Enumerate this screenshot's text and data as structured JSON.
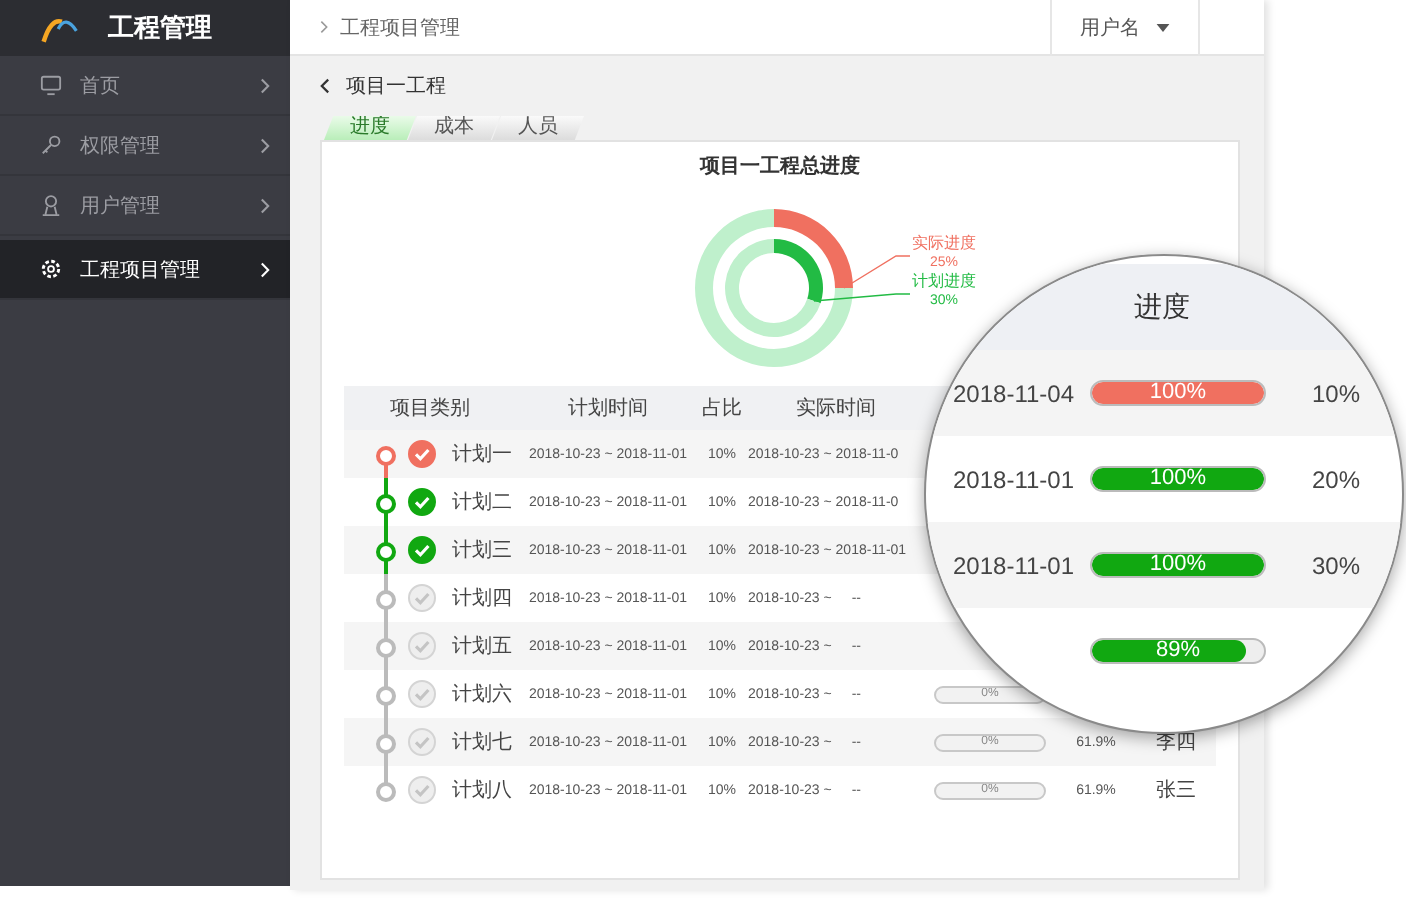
{
  "sidebar": {
    "title": "工程管理",
    "items": [
      {
        "label": "首页",
        "selected": false
      },
      {
        "label": "权限管理",
        "selected": false
      },
      {
        "label": "用户管理",
        "selected": false
      },
      {
        "label": "工程项目管理",
        "selected": true
      }
    ]
  },
  "topbar": {
    "breadcrumb": "工程项目管理",
    "user": "用户名"
  },
  "page": {
    "title": "项目一工程",
    "tabs": [
      {
        "label": "进度",
        "selected": true
      },
      {
        "label": "成本",
        "selected": false
      },
      {
        "label": "人员",
        "selected": false
      }
    ]
  },
  "chart": {
    "title": "项目一工程总进度",
    "rings": [
      {
        "color": "#f07060",
        "value": "25%",
        "chart_data": {
          "type": "donut",
          "title": "实际进度",
          "values": [
            25,
            75
          ]
        }
      },
      {
        "color": "#22bb44",
        "value": "30%",
        "chart_data": {
          "type": "donut",
          "title": "计划进度",
          "values": [
            30,
            70
          ]
        }
      }
    ]
  },
  "table": {
    "columns": [
      "项目类别",
      "计划时间",
      "占比",
      "实际时间"
    ],
    "rows": [
      {
        "kind": "current",
        "name": "计划一",
        "plan": "2018-10-23 ~ 2018-11-01",
        "ratio": "10%",
        "actual": "2018-10-23 ~ 2018-11-0"
      },
      {
        "kind": "done",
        "name": "计划二",
        "plan": "2018-10-23 ~ 2018-11-01",
        "ratio": "10%",
        "actual": "2018-10-23 ~ 2018-11-0"
      },
      {
        "kind": "done",
        "name": "计划三",
        "plan": "2018-10-23 ~ 2018-11-01",
        "ratio": "10%",
        "actual": "2018-10-23 ~ 2018-11-01"
      },
      {
        "kind": "pending",
        "name": "计划四",
        "plan": "2018-10-23 ~ 2018-11-01",
        "ratio": "10%",
        "actual": "2018-10-23 ~",
        "actual_end": "--"
      },
      {
        "kind": "pending",
        "name": "计划五",
        "plan": "2018-10-23 ~ 2018-11-01",
        "ratio": "10%",
        "actual": "2018-10-23 ~",
        "actual_end": "--"
      },
      {
        "kind": "pending",
        "name": "计划六",
        "plan": "2018-10-23 ~ 2018-11-01",
        "ratio": "10%",
        "actual": "2018-10-23 ~",
        "actual_end": "--",
        "progress": {
          "level": 0,
          "label": "0%"
        }
      },
      {
        "kind": "pending",
        "name": "计划七",
        "plan": "2018-10-23 ~ 2018-11-01",
        "ratio": "10%",
        "actual": "2018-10-23 ~",
        "actual_end": "--",
        "progress": {
          "level": 0,
          "label": "0%"
        },
        "share": "61.9%",
        "person": "李四"
      },
      {
        "kind": "pending",
        "name": "计划八",
        "plan": "2018-10-23 ~ 2018-11-01",
        "ratio": "10%",
        "actual": "2018-10-23 ~",
        "actual_end": "--",
        "progress": {
          "level": 0,
          "label": "0%"
        },
        "share": "61.9%",
        "person": "张三"
      }
    ]
  },
  "magnifier": {
    "column": "进度",
    "rows": [
      {
        "date": "2018-11-04",
        "progress": {
          "level": 1,
          "label": "100%",
          "color": "#f07060"
        },
        "ratio": "10%"
      },
      {
        "date": "2018-11-01",
        "progress": {
          "level": 1,
          "label": "100%",
          "color": "#11a811"
        },
        "ratio": "20%"
      },
      {
        "date": "2018-11-01",
        "progress": {
          "level": 1,
          "label": "100%",
          "color": "#11a811"
        },
        "ratio": "30%"
      },
      {
        "progress": {
          "level": 0.89,
          "label": "89%",
          "color": "#11a811"
        }
      }
    ]
  }
}
